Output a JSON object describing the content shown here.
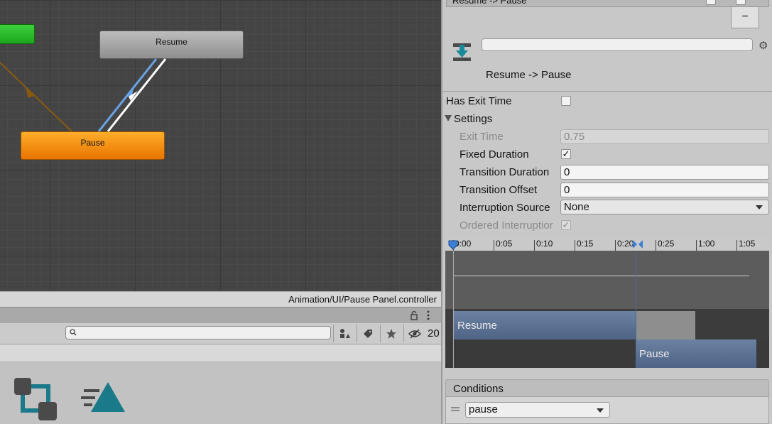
{
  "graph": {
    "nodes": {
      "resume": "Resume",
      "pause": "Pause"
    },
    "controller_path": "Animation/UI/Pause Panel.controller"
  },
  "project": {
    "search": {
      "value": "",
      "placeholder": ""
    },
    "hidden_count": "20",
    "icons": [
      "lock-icon",
      "menu-icon",
      "search-icon",
      "filter-type-icon",
      "label-icon",
      "favorite-icon",
      "hidden-packages-icon",
      "animator-controller-icon",
      "animation-clip-icon"
    ]
  },
  "inspector": {
    "list_header": "Resume -> Pause",
    "remove_label": "−",
    "name_field": "",
    "transition_title": "Resume -> Pause",
    "has_exit_time": {
      "label": "Has Exit Time",
      "checked": false
    },
    "settings_label": "Settings",
    "exit_time": {
      "label": "Exit Time",
      "value": "0.75"
    },
    "fixed_duration": {
      "label": "Fixed Duration",
      "checked": true
    },
    "transition_duration": {
      "label": "Transition Duration",
      "value": "0"
    },
    "transition_offset": {
      "label": "Transition Offset",
      "value": "0"
    },
    "interruption_source": {
      "label": "Interruption Source",
      "value": "None"
    },
    "ordered_interruption": {
      "label": "Ordered Interruptior",
      "checked": true
    },
    "timeline": {
      "ticks": [
        "0:00",
        "0:05",
        "0:10",
        "0:15",
        "0:20",
        "0:25",
        "1:00",
        "1:05"
      ],
      "clips": {
        "resume": "Resume",
        "pause": "Pause"
      }
    },
    "conditions": {
      "header": "Conditions",
      "parameter": "pause"
    }
  },
  "colors": {
    "entry_node": "#1ca51c",
    "pause_node": "#e87500",
    "resume_node": "#a0a0a0",
    "transition_selected": "#6aa3e8",
    "transition_default": "#ffffff",
    "transition_entry": "#8a5a10",
    "timeline_clip": "#5a7095",
    "accent_icon": "#1a7a8a"
  }
}
